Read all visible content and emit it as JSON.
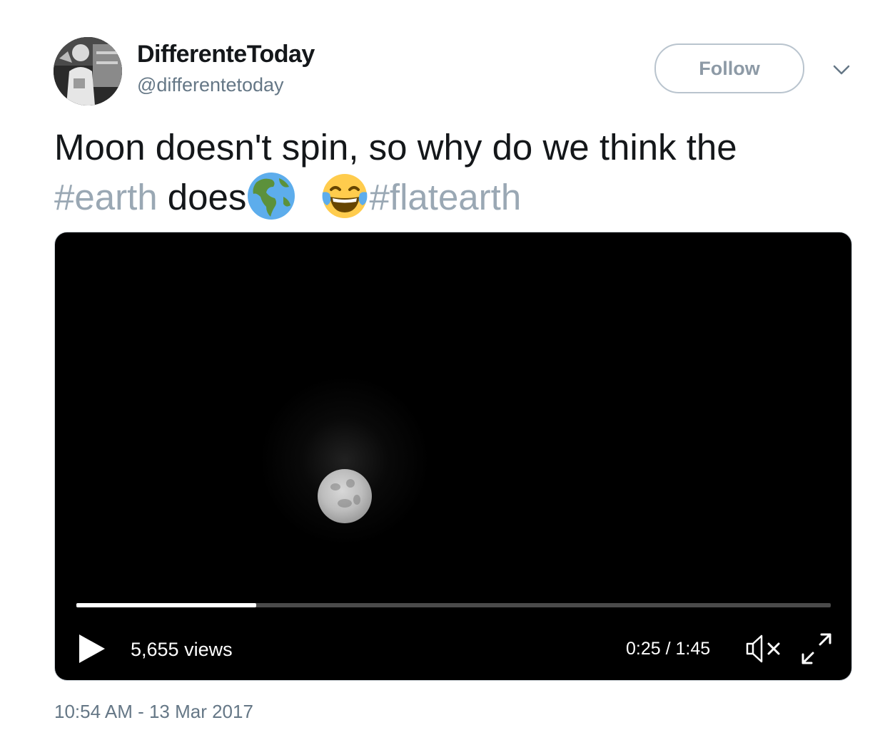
{
  "author": {
    "display_name": "DifferenteToday",
    "handle": "@differentetoday",
    "avatar_icon": "profile-photo"
  },
  "header": {
    "follow_label": "Follow",
    "menu_icon": "chevron-down-icon"
  },
  "tweet": {
    "line1": "Moon doesn't spin, so why do we think the",
    "hashtag1": "#earth",
    "word_does": "does",
    "emoji1": "earth-globe-americas",
    "emoji2": "face-with-tears-of-joy",
    "hashtag2": "#flatearth"
  },
  "video": {
    "views": "5,655 views",
    "time": "0:25 / 1:45",
    "progress": 0.238,
    "play_icon": "play-icon",
    "mute_icon": "muted-speaker-icon",
    "fullscreen_icon": "fullscreen-icon"
  },
  "timestamp": "10:54 AM - 13 Mar 2017",
  "colors": {
    "text": "#14171a",
    "secondary": "#657786",
    "hashtag": "#9aa8b4",
    "follow_border": "#b9c4ce",
    "video_bg": "#000000"
  }
}
